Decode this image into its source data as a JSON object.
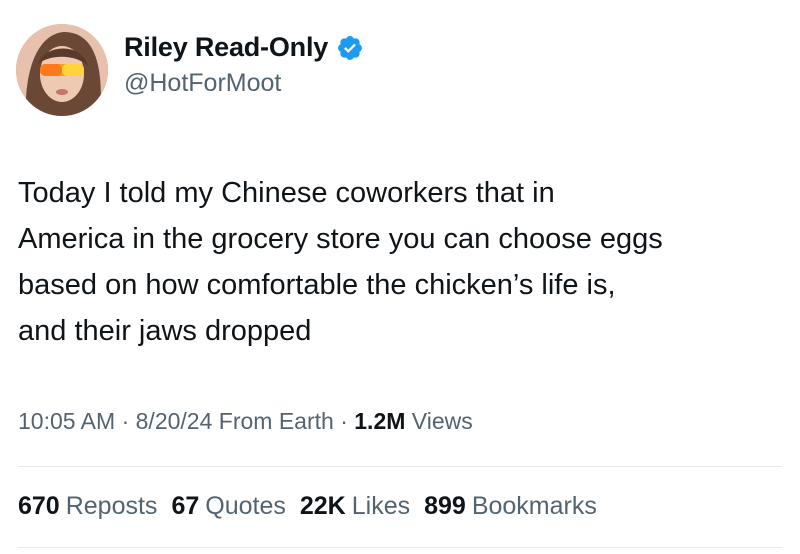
{
  "author": {
    "display_name": "Riley Read-Only",
    "handle": "@HotForMoot",
    "verified_color": "#1d9bf0",
    "avatar_icon": "profile-photo"
  },
  "tweet": {
    "lines": [
      "Today I told my Chinese coworkers that in",
      "America in the grocery store you can choose eggs",
      "based on how comfortable the chicken’s life is,",
      "and their jaws dropped"
    ]
  },
  "meta": {
    "time": "10:05 AM",
    "sep1": "·",
    "date": "8/20/24",
    "source": "From Earth",
    "sep2": "·",
    "views_count": "1.2M",
    "views_label": "Views"
  },
  "stats": {
    "reposts_count": "670",
    "reposts_label": "Reposts",
    "quotes_count": "67",
    "quotes_label": "Quotes",
    "likes_count": "22K",
    "likes_label": "Likes",
    "bookmarks_count": "899",
    "bookmarks_label": "Bookmarks"
  }
}
